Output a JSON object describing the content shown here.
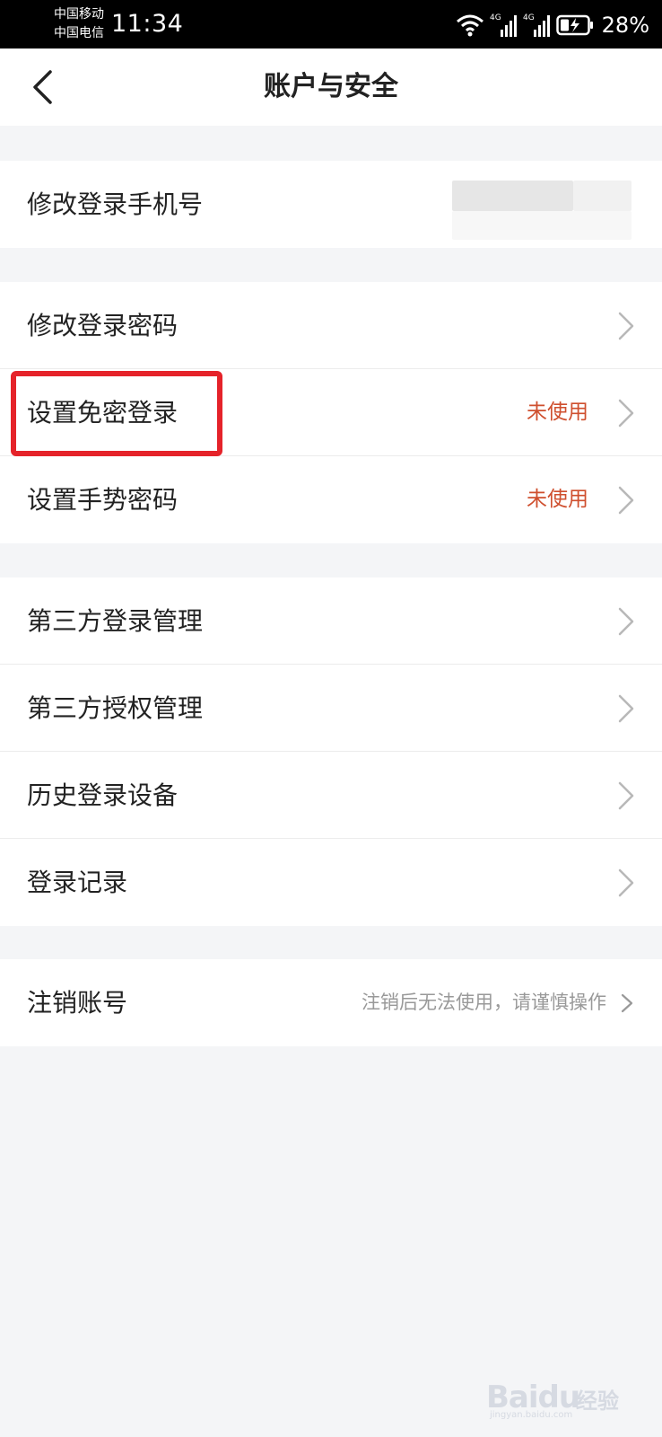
{
  "status_bar": {
    "carrier_1": "中国移动",
    "carrier_2": "中国电信",
    "time": "11:34",
    "network_1": "4G",
    "network_2": "4G",
    "battery_percent": "28%",
    "icons": [
      "wifi-icon",
      "signal-icon",
      "battery-charging-icon"
    ]
  },
  "header": {
    "title": "账户与安全",
    "back_icon": "chevron-left-icon"
  },
  "groups": [
    {
      "items": [
        {
          "label": "修改登录手机号",
          "value": "",
          "obscured": true
        }
      ]
    },
    {
      "items": [
        {
          "label": "修改登录密码",
          "value": ""
        },
        {
          "label": "设置免密登录",
          "value": "未使用",
          "highlighted": true
        },
        {
          "label": "设置手势密码",
          "value": "未使用"
        }
      ]
    },
    {
      "items": [
        {
          "label": "第三方登录管理",
          "value": ""
        },
        {
          "label": "第三方授权管理",
          "value": ""
        },
        {
          "label": "历史登录设备",
          "value": ""
        },
        {
          "label": "登录记录",
          "value": ""
        }
      ]
    },
    {
      "items": [
        {
          "label": "注销账号",
          "value": "注销后无法使用，请谨慎操作"
        }
      ]
    }
  ],
  "watermark": {
    "logo": "Baidu",
    "text": "经验",
    "url": "jingyan.baidu.com"
  },
  "colors": {
    "value_accent": "#cf4f2e",
    "highlight": "#e5232a",
    "background": "#f4f5f7"
  }
}
